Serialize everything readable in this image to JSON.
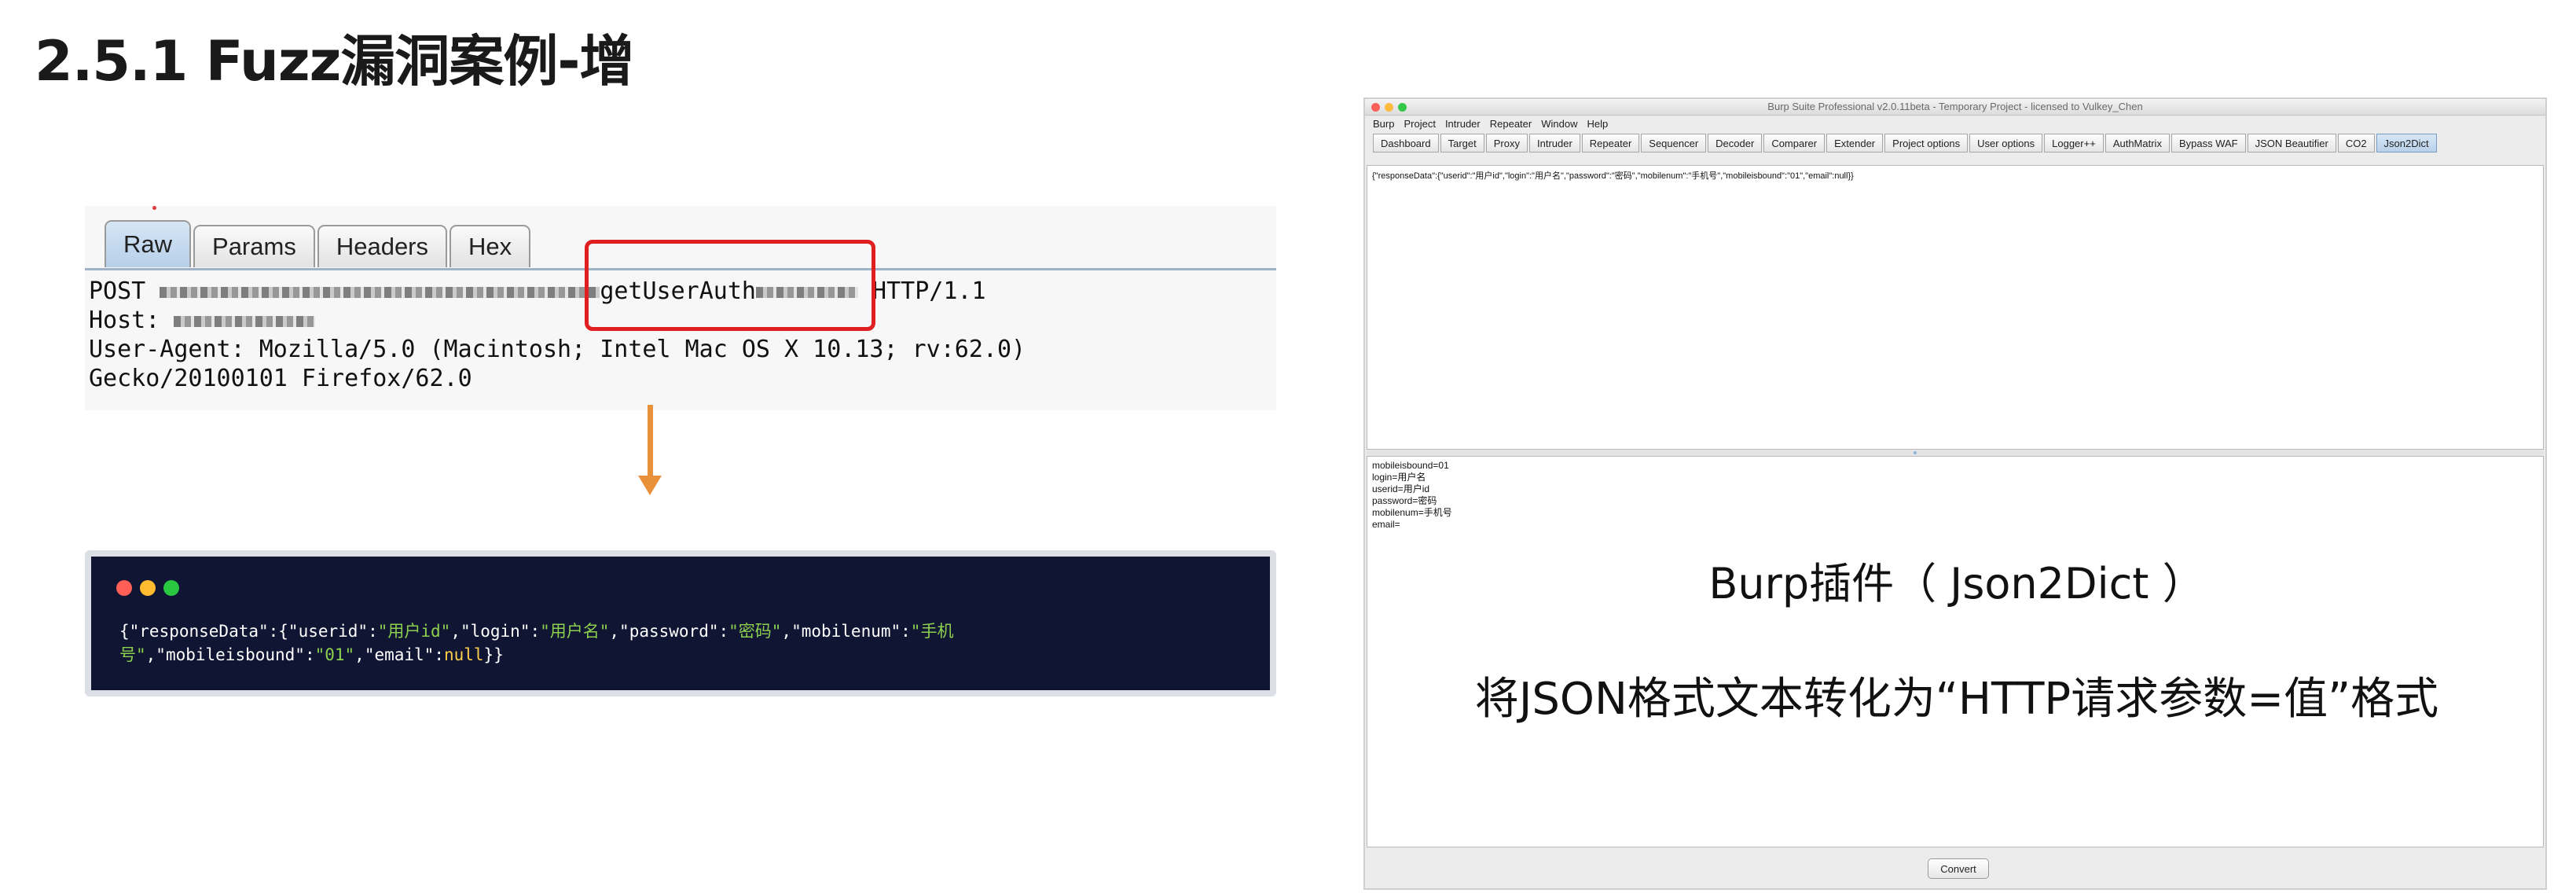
{
  "slide": {
    "title": "2.5.1 Fuzz漏洞案例-增"
  },
  "request": {
    "tabs": [
      "Raw",
      "Params",
      "Headers",
      "Hex"
    ],
    "active_tab": "Raw",
    "line1_prefix": "POST ",
    "line1_endpoint": "getUserAuth",
    "line1_suffix": " HTTP/1.1",
    "line2": "Host: ",
    "line3": "User-Agent: Mozilla/5.0 (Macintosh; Intel Mac OS X 10.13; rv:62.0)",
    "line4": "Gecko/20100101 Firefox/62.0",
    "highlight_color": "#e02020"
  },
  "arrow": {
    "icon": "arrow-down-icon",
    "color": "#e9903a"
  },
  "code_card": {
    "dots": [
      "red-dot",
      "yellow-dot",
      "green-dot"
    ],
    "line1": [
      "{\"responseData\":{\"userid\":",
      "\"用户id\"",
      ",\"login\":",
      "\"用户名\"",
      ",\"password\":",
      "\"密码\"",
      ",\"mobilenum\":",
      "\"手机"
    ],
    "line2": [
      "号\"",
      ",\"mobileisbound\":",
      "\"01\"",
      ",\"email\":",
      "null",
      "}}"
    ]
  },
  "burp": {
    "window_title": "Burp Suite Professional v2.0.11beta - Temporary Project - licensed to Vulkey_Chen",
    "menu": [
      "Burp",
      "Project",
      "Intruder",
      "Repeater",
      "Window",
      "Help"
    ],
    "tabs": [
      "Dashboard",
      "Target",
      "Proxy",
      "Intruder",
      "Repeater",
      "Sequencer",
      "Decoder",
      "Comparer",
      "Extender",
      "Project options",
      "User options",
      "Logger++",
      "AuthMatrix",
      "Bypass WAF",
      "JSON Beautifier",
      "CO2",
      "Json2Dict"
    ],
    "active_tab": "Json2Dict",
    "input_text": "{\"responseData\":{\"userid\":\"用户id\",\"login\":\"用户名\",\"password\":\"密码\",\"mobilenum\":\"手机号\",\"mobileisbound\":\"01\",\"email\":null}}",
    "output_lines": [
      "mobileisbound=01",
      "login=用户名",
      "userid=用户id",
      "password=密码",
      "mobilenum=手机号",
      "email="
    ],
    "overlay_title": "Burp插件（ Json2Dict ）",
    "overlay_desc": "将JSON格式文本转化为“HTTP请求参数=值”格式",
    "convert_label": "Convert"
  }
}
